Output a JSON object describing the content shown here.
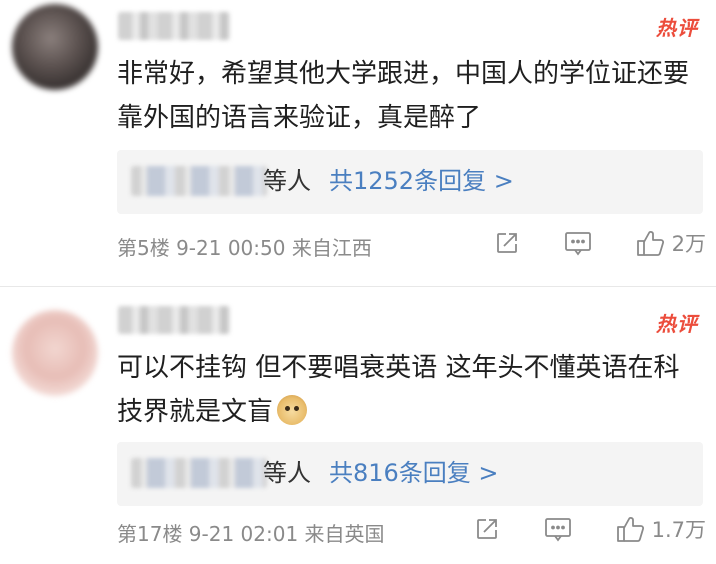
{
  "hot_label": "热评",
  "comments": [
    {
      "content": "非常好，希望其他大学跟进，中国人的学位证还要靠外国的语言来验证，真是醉了",
      "reply_etc": "等人",
      "reply_link": "共1252条回复 >",
      "meta": "第5楼  9-21 00:50  来自江西",
      "likes": "2万"
    },
    {
      "content": "可以不挂钩 但不要唱衰英语 这年头不懂英语在科技界就是文盲",
      "reply_etc": "等人",
      "reply_link": "共816条回复 >",
      "meta": "第17楼  9-21 02:01  来自英国",
      "likes": "1.7万"
    }
  ],
  "icons": [
    "share-icon",
    "comment-icon",
    "like-icon"
  ],
  "colors": {
    "hot": "#ec4d3c",
    "link": "#4a7fc0",
    "meta": "#8a8a8a",
    "reply_bg": "#f4f4f4"
  }
}
